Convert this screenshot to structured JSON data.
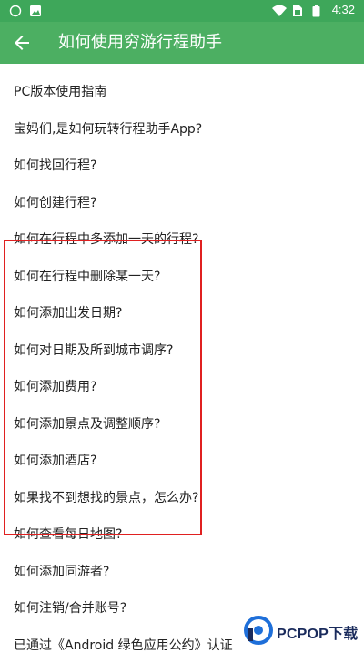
{
  "status_bar": {
    "time": "4:32",
    "left_icons": [
      "chat-icon",
      "image-icon"
    ],
    "right_icons": [
      "wifi-icon",
      "sim-icon",
      "battery-icon"
    ]
  },
  "app_bar": {
    "title": "如何使用穷游行程助手",
    "back_icon": "arrow-left-icon"
  },
  "items": [
    "PC版本使用指南",
    "宝妈们,是如何玩转行程助手App?",
    "如何找回行程?",
    "如何创建行程?",
    "如何在行程中多添加一天的行程?",
    "如何在行程中删除某一天?",
    "如何添加出发日期?",
    "如何对日期及所到城市调序?",
    "如何添加费用?",
    "如何添加景点及调整顺序?",
    "如何添加酒店?",
    "如果找不到想找的景点，怎么办?",
    "如何查看每日地图?",
    "如何添加同游者?",
    "如何注销/合并账号?",
    "已通过《Android 绿色应用公约》认证"
  ],
  "watermark": {
    "logo_text": "PCPOP下载",
    "accent_color": "#1e6fd9"
  },
  "colors": {
    "status_bar": "#3ea75a",
    "app_bar": "#4caf62",
    "highlight_border": "#e02020"
  }
}
